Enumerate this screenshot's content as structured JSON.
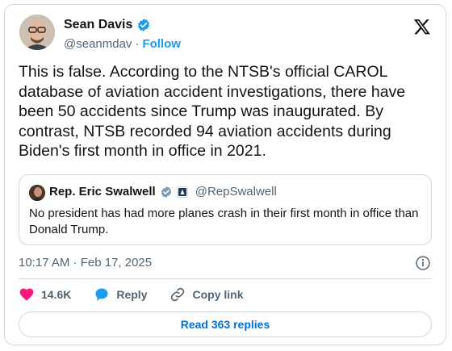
{
  "author": {
    "name": "Sean Davis",
    "handle": "@seanmdav",
    "separator": "·",
    "follow_label": "Follow"
  },
  "tweet_text": "This is false. According to the NTSB's official CAROL database of aviation accident investigations, there have been 50 accidents since Trump was inaugurated. By contrast, NTSB recorded 94 aviation accidents during Biden's first month in office in 2021.",
  "quoted": {
    "name": "Rep. Eric Swalwell",
    "handle": "@RepSwalwell",
    "text": "No president has had more planes crash in their first month in office than Donald Trump."
  },
  "timestamp": "10:17 AM · Feb 17, 2025",
  "actions": {
    "likes": "14.6K",
    "reply_label": "Reply",
    "copy_label": "Copy link"
  },
  "read_replies_label": "Read 363 replies",
  "colors": {
    "accent": "#1d9bf0",
    "like": "#f91880",
    "text": "#0f1419",
    "muted": "#536471",
    "border": "#cfd9de"
  },
  "icons": [
    "verified-badge-icon",
    "x-logo-icon",
    "info-icon",
    "heart-icon",
    "reply-bubble-icon",
    "link-icon",
    "government-label-icon"
  ]
}
